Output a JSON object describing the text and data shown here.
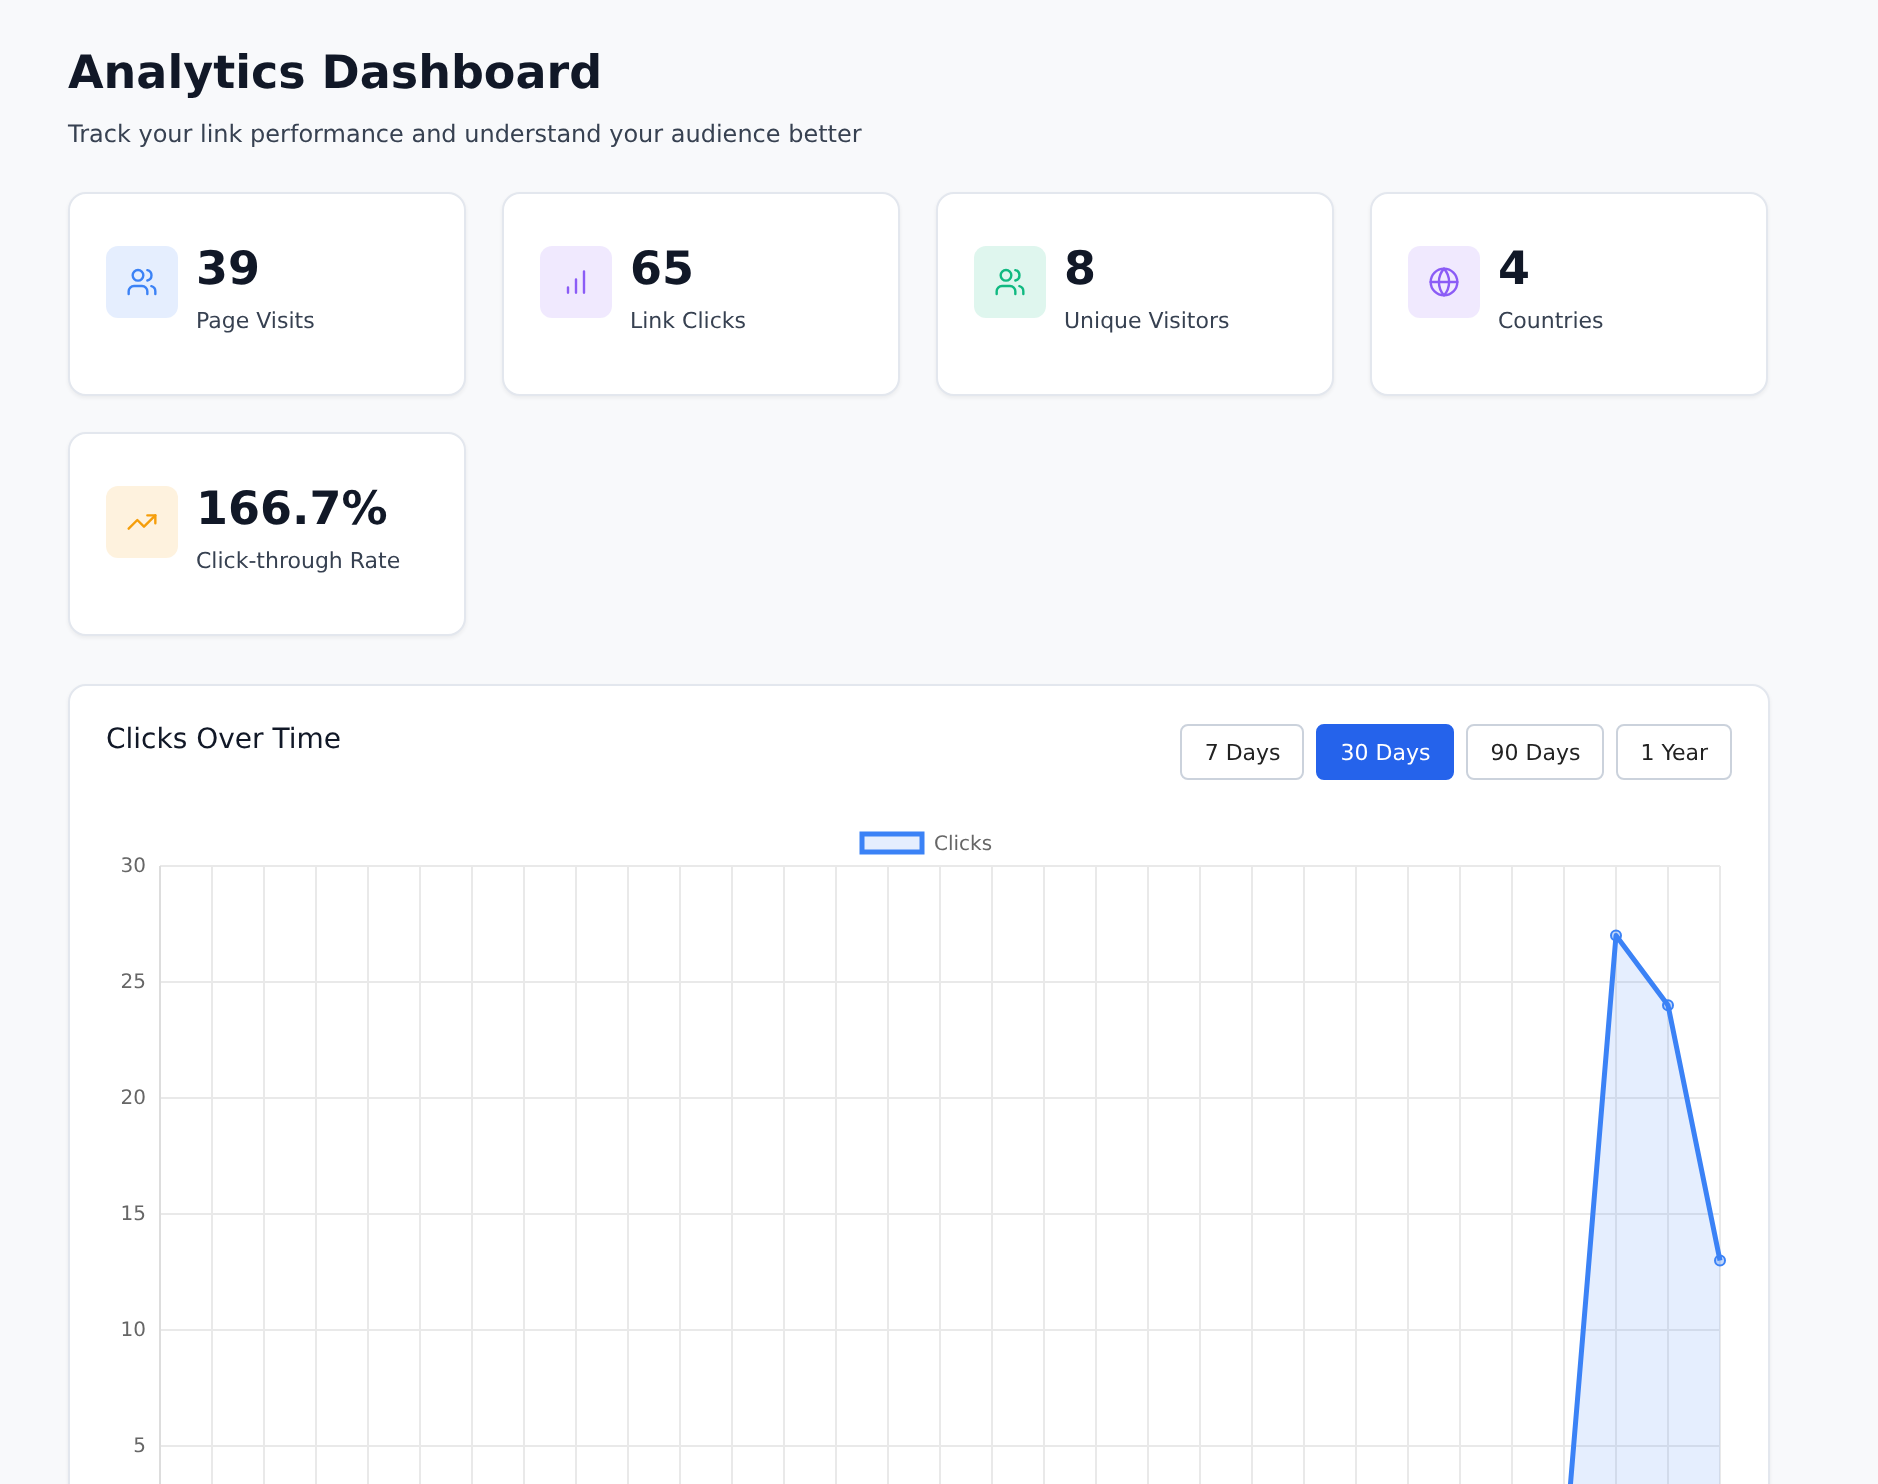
{
  "header": {
    "title": "Analytics Dashboard",
    "subtitle": "Track your link performance and understand your audience better"
  },
  "stats": [
    {
      "kind": "visits",
      "value": "39",
      "label": "Page Visits",
      "color": "#3b82f6"
    },
    {
      "kind": "clicks",
      "value": "65",
      "label": "Link Clicks",
      "color": "#8b5cf6"
    },
    {
      "kind": "visitors",
      "value": "8",
      "label": "Unique Visitors",
      "color": "#10b981"
    },
    {
      "kind": "countries",
      "value": "4",
      "label": "Countries",
      "color": "#8b5cf6"
    },
    {
      "kind": "rate",
      "value": "166.7%",
      "label": "Click-through Rate",
      "color": "#f59e0b"
    }
  ],
  "chart_panel": {
    "title": "Clicks Over Time",
    "ranges": [
      {
        "label": "7 Days",
        "selected": false
      },
      {
        "label": "30 Days",
        "selected": true
      },
      {
        "label": "90 Days",
        "selected": false
      },
      {
        "label": "1 Year",
        "selected": false
      }
    ],
    "chart_data": {
      "type": "area",
      "grid": true,
      "ylim": [
        0,
        30
      ],
      "yticks": [
        5,
        10,
        15,
        20,
        25,
        30
      ],
      "series": [
        {
          "name": "Clicks",
          "color": "#3b82f6",
          "values": [
            0,
            0,
            0,
            0,
            0,
            0,
            0,
            0,
            0,
            0,
            0,
            0,
            0,
            0,
            0,
            0,
            0,
            0,
            0,
            0,
            0,
            0,
            0,
            0,
            0,
            0,
            0,
            0,
            27,
            24,
            13
          ]
        }
      ]
    }
  }
}
